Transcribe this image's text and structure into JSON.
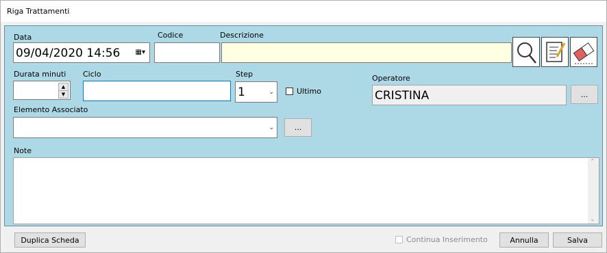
{
  "window": {
    "title": "Riga Trattamenti"
  },
  "fields": {
    "data": {
      "label": "Data",
      "value": "09/04/2020 14:56"
    },
    "codice": {
      "label": "Codice",
      "value": ""
    },
    "descrizione": {
      "label": "Descrizione",
      "value": ""
    },
    "durata": {
      "label": "Durata minuti",
      "value": ""
    },
    "ciclo": {
      "label": "Ciclo",
      "value": ""
    },
    "step": {
      "label": "Step",
      "value": "1"
    },
    "ultimo": {
      "label": "Ultimo",
      "checked": false
    },
    "operatore": {
      "label": "Operatore",
      "value": "CRISTINA",
      "browse_label": "..."
    },
    "elemento": {
      "label": "Elemento Associato",
      "value": "",
      "browse_label": "..."
    },
    "note": {
      "label": "Note",
      "value": ""
    }
  },
  "toolbar_icons": [
    "search-icon",
    "edit-document-icon",
    "eraser-icon"
  ],
  "footer": {
    "duplica_label": "Duplica Scheda",
    "continua_label": "Continua Inserimento",
    "annulla_label": "Annulla",
    "salva_label": "Salva"
  },
  "colors": {
    "panel": "#add8e6",
    "descrizione_bg": "#ffffe1"
  }
}
